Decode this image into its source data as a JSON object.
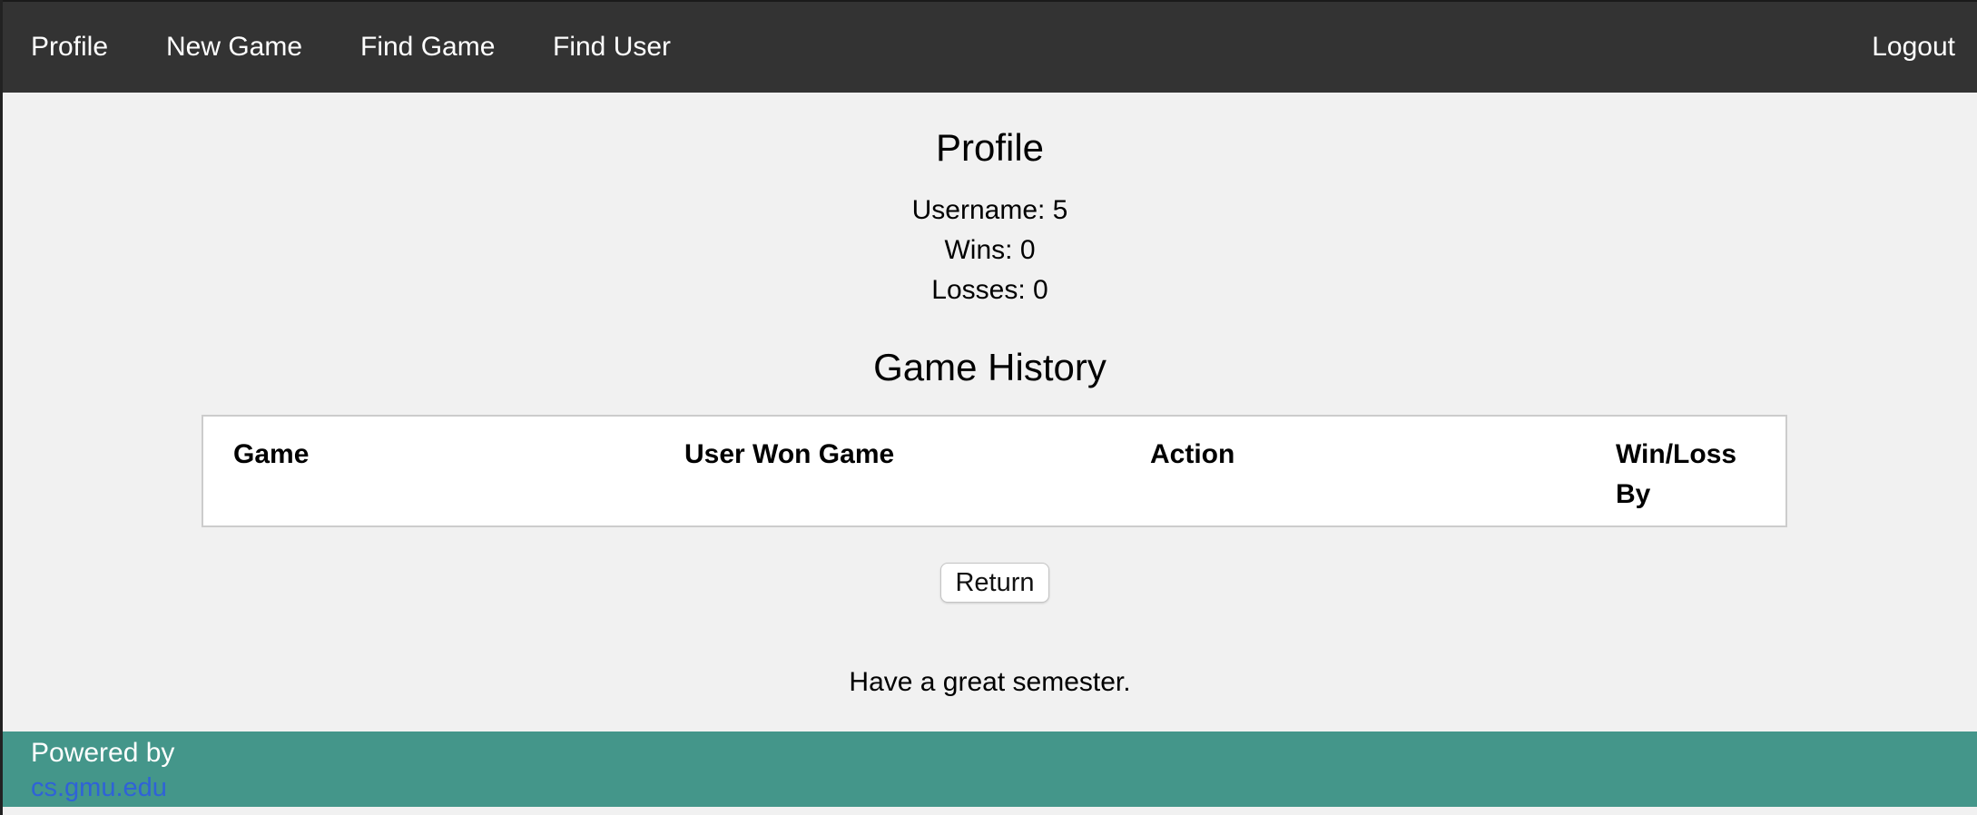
{
  "nav": {
    "profile": "Profile",
    "new_game": "New Game",
    "find_game": "Find Game",
    "find_user": "Find User",
    "logout": "Logout"
  },
  "profile": {
    "title": "Profile",
    "username": "Username: 5",
    "wins": "Wins: 0",
    "losses": "Losses: 0"
  },
  "history": {
    "title": "Game History",
    "columns": [
      "Game",
      "User Won Game",
      "Action",
      "Win/Loss By"
    ],
    "rows": []
  },
  "return_button": "Return",
  "closing_text": "Have a great semester.",
  "footer": {
    "powered_by": "Powered by",
    "link_text": "cs.gmu.edu"
  },
  "colors": {
    "navbar_bg": "#333333",
    "page_bg": "#f1f1f1",
    "footer_bg": "#44968a",
    "link": "#2f62d8"
  }
}
